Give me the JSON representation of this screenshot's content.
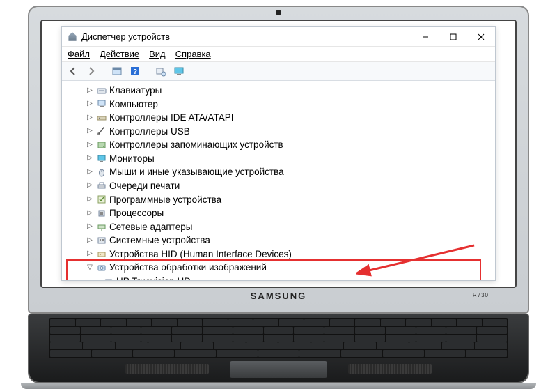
{
  "laptop": {
    "brand": "SAMSUNG",
    "model": "R730"
  },
  "window": {
    "title": "Диспетчер устройств"
  },
  "menubar": {
    "file": "Файл",
    "action": "Действие",
    "view": "Вид",
    "help": "Справка"
  },
  "toolbar_icons": {
    "back": "back-icon",
    "forward": "forward-icon",
    "up": "show-hidden-icon",
    "help": "help-icon",
    "scan": "scan-icon",
    "monitor": "monitor-icon"
  },
  "tree": {
    "items": [
      {
        "label": "Клавиатуры",
        "icon": "keyboard"
      },
      {
        "label": "Компьютер",
        "icon": "computer"
      },
      {
        "label": "Контроллеры IDE ATA/ATAPI",
        "icon": "ide"
      },
      {
        "label": "Контроллеры USB",
        "icon": "usb"
      },
      {
        "label": "Контроллеры запоминающих устройств",
        "icon": "storage"
      },
      {
        "label": "Мониторы",
        "icon": "monitor"
      },
      {
        "label": "Мыши и иные указывающие устройства",
        "icon": "mouse"
      },
      {
        "label": "Очереди печати",
        "icon": "printer"
      },
      {
        "label": "Программные устройства",
        "icon": "software"
      },
      {
        "label": "Процессоры",
        "icon": "cpu"
      },
      {
        "label": "Сетевые адаптеры",
        "icon": "network"
      },
      {
        "label": "Системные устройства",
        "icon": "system"
      },
      {
        "label": "Устройства HID (Human Interface Devices)",
        "icon": "hid"
      }
    ],
    "expanded": {
      "label": "Устройства обработки изображений",
      "icon": "imaging",
      "child": {
        "label": "HP Truevision HD",
        "icon": "camera"
      }
    }
  }
}
